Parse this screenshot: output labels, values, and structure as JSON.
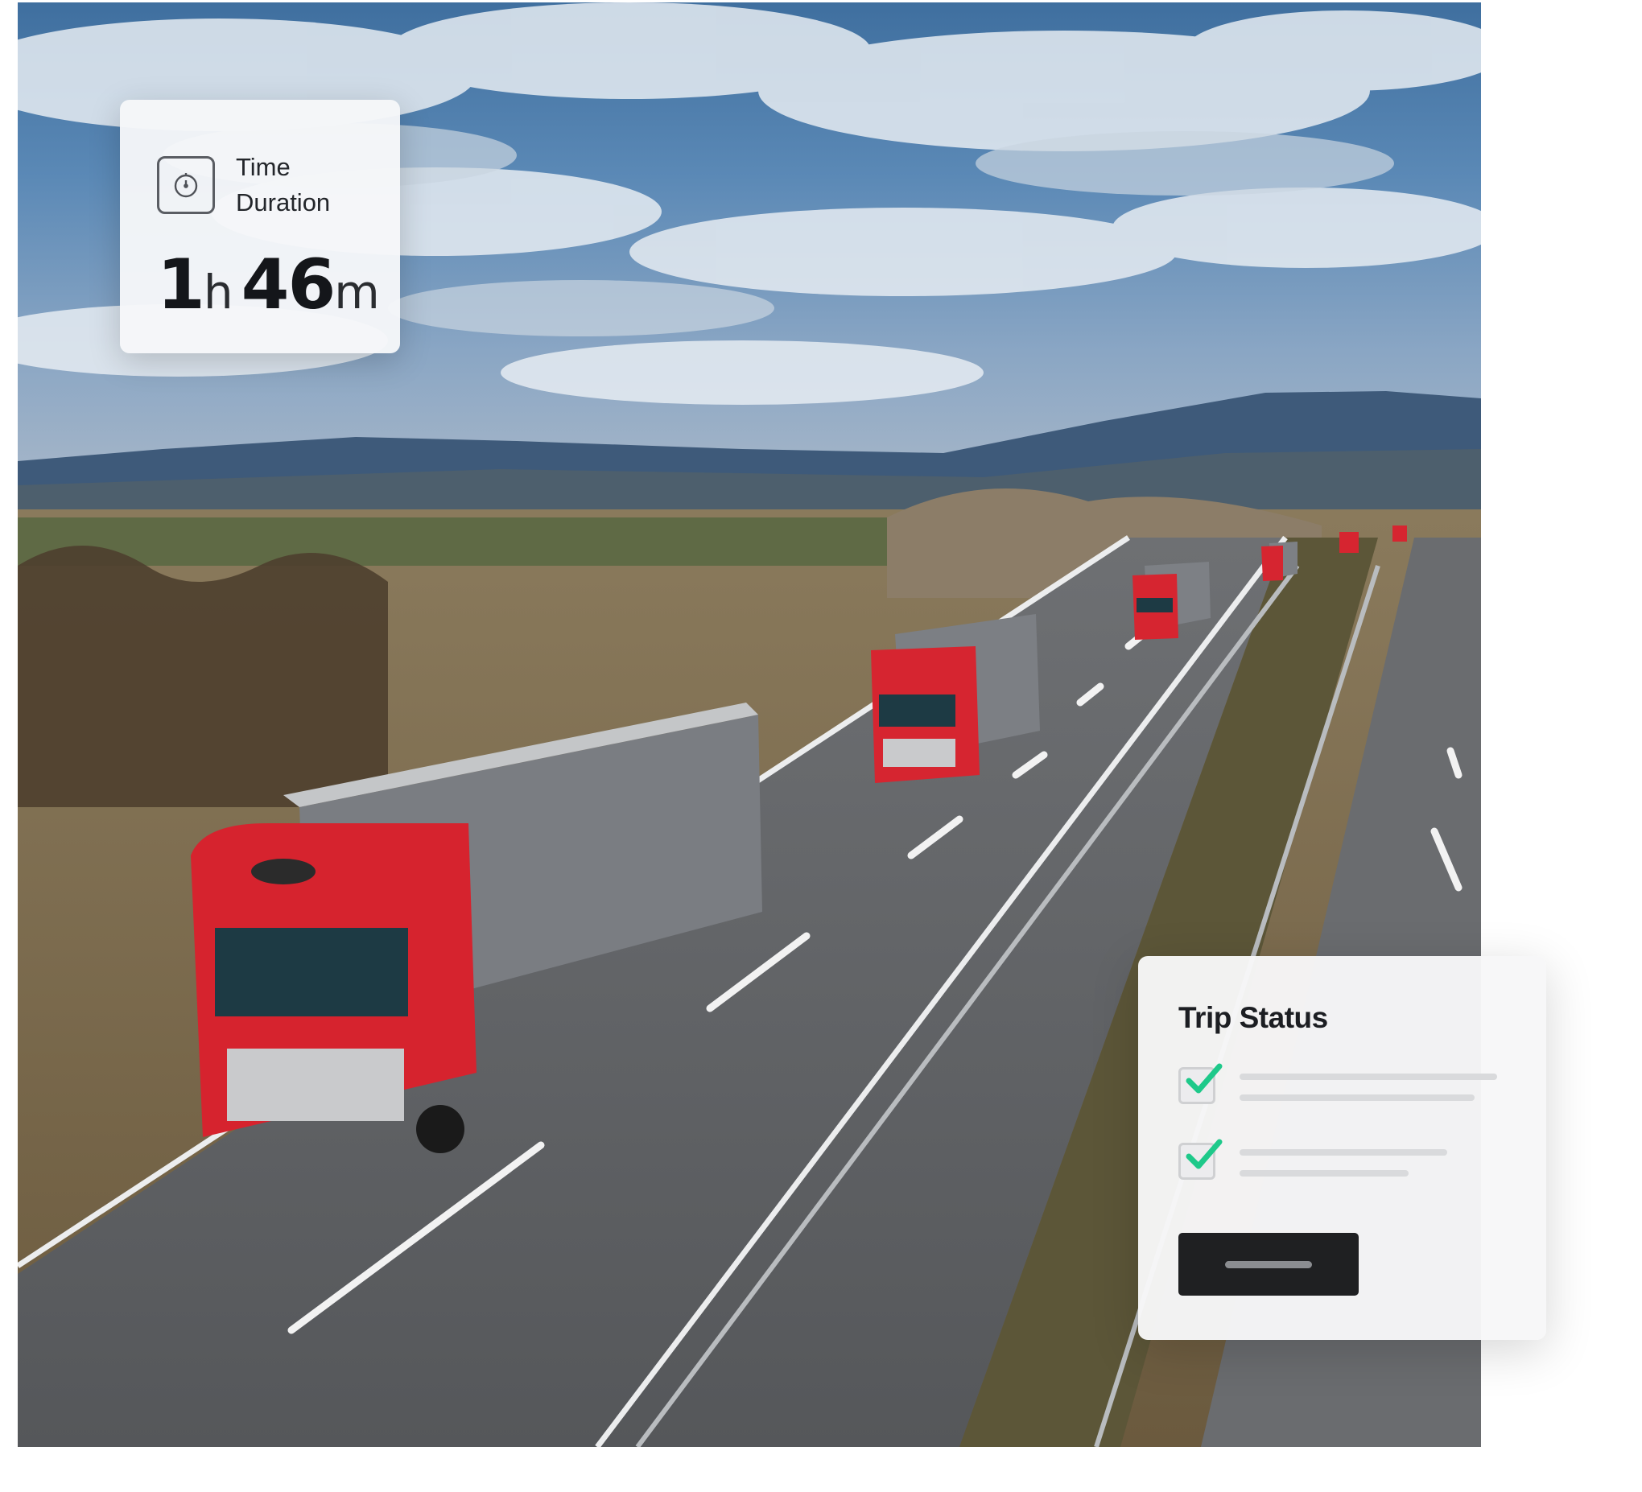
{
  "duration_card": {
    "label": "Time Duration",
    "hours": "1",
    "hours_unit": "h",
    "minutes": "46",
    "minutes_unit": "m",
    "icon": "stopwatch-icon"
  },
  "trip_status_card": {
    "title": "Trip Status",
    "items": [
      {
        "checked": true,
        "icon": "checkmark-icon"
      },
      {
        "checked": true,
        "icon": "checkmark-icon"
      }
    ],
    "check_color": "#1ec98a",
    "button_color": "#1f2022"
  },
  "hero_image": {
    "subject": "convoy of red trucks on highway"
  }
}
